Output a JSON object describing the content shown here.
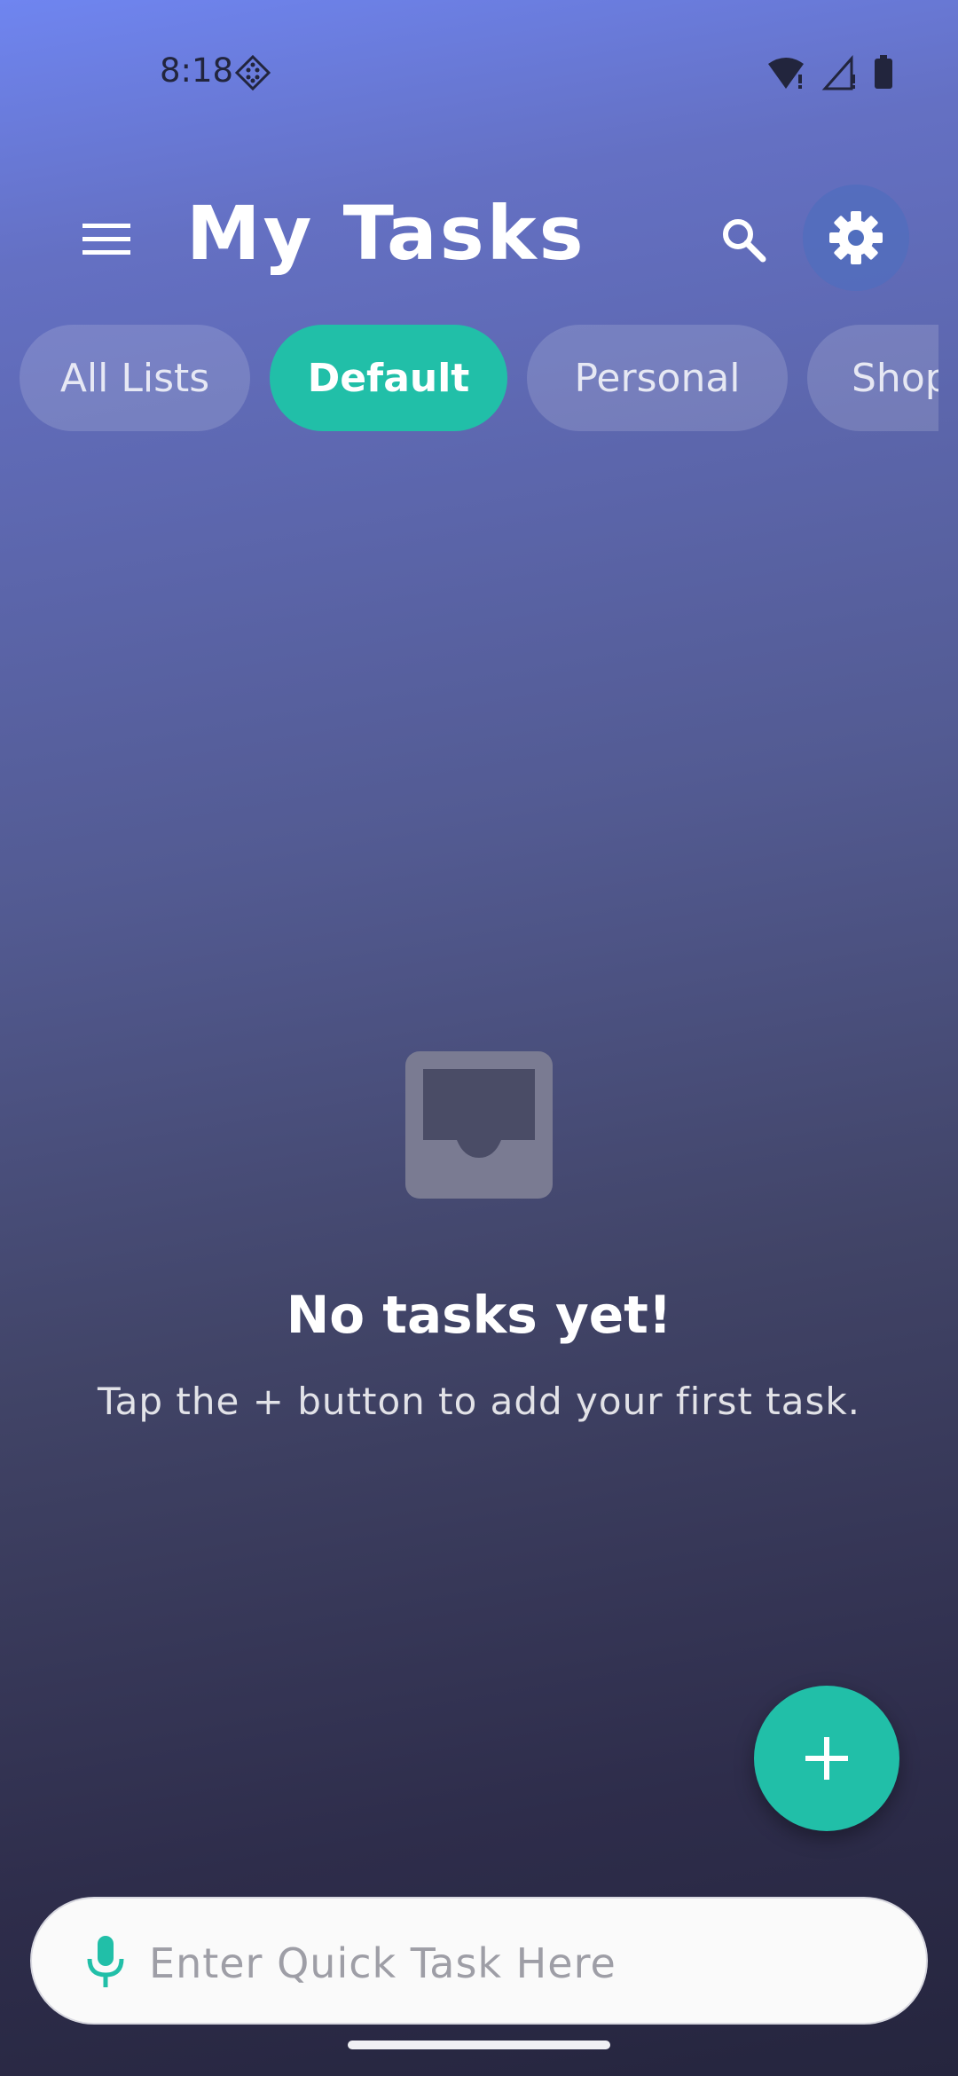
{
  "status_bar": {
    "time": "8:18"
  },
  "header": {
    "title": "My Tasks"
  },
  "tabs": [
    {
      "label": "All Lists",
      "active": false
    },
    {
      "label": "Default",
      "active": true
    },
    {
      "label": "Personal",
      "active": false
    },
    {
      "label": "Shopping",
      "active": false
    }
  ],
  "empty_state": {
    "icon": "inbox-icon",
    "title": "No tasks yet!",
    "subtitle": "Tap the + button to add your first task."
  },
  "quick_task": {
    "placeholder": "Enter Quick Task Here",
    "value": ""
  },
  "icons": {
    "menu": "hamburger-menu-icon",
    "search": "search-icon",
    "settings": "gear-icon",
    "add": "plus-icon",
    "mic": "microphone-icon"
  },
  "colors": {
    "accent": "#21bfa8",
    "status_text": "#22253d"
  }
}
